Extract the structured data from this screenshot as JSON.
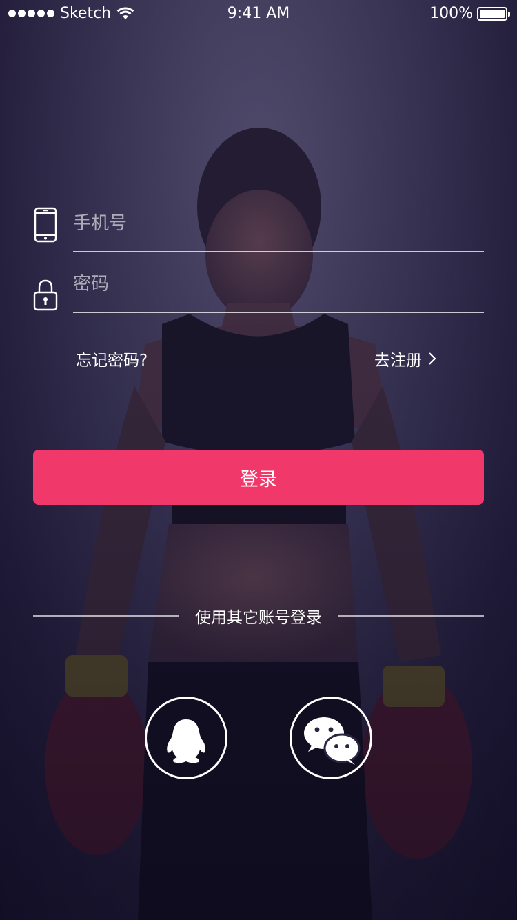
{
  "status_bar": {
    "carrier": "Sketch",
    "time": "9:41 AM",
    "battery": "100%",
    "battery_level": 1.0
  },
  "form": {
    "phone": {
      "placeholder": "手机号",
      "value": "",
      "icon": "phone-icon"
    },
    "password": {
      "placeholder": "密码",
      "value": "",
      "icon": "lock-icon"
    },
    "forgot_password": "忘记密码?",
    "register": "去注册",
    "register_chevron": "›",
    "login_button": "登录"
  },
  "other_login": {
    "label": "使用其它账号登录",
    "options": [
      {
        "name": "qq",
        "icon": "qq-penguin-icon"
      },
      {
        "name": "wechat",
        "icon": "wechat-icon"
      }
    ]
  },
  "colors": {
    "accent": "#f0386b",
    "background": "#2e2848"
  }
}
